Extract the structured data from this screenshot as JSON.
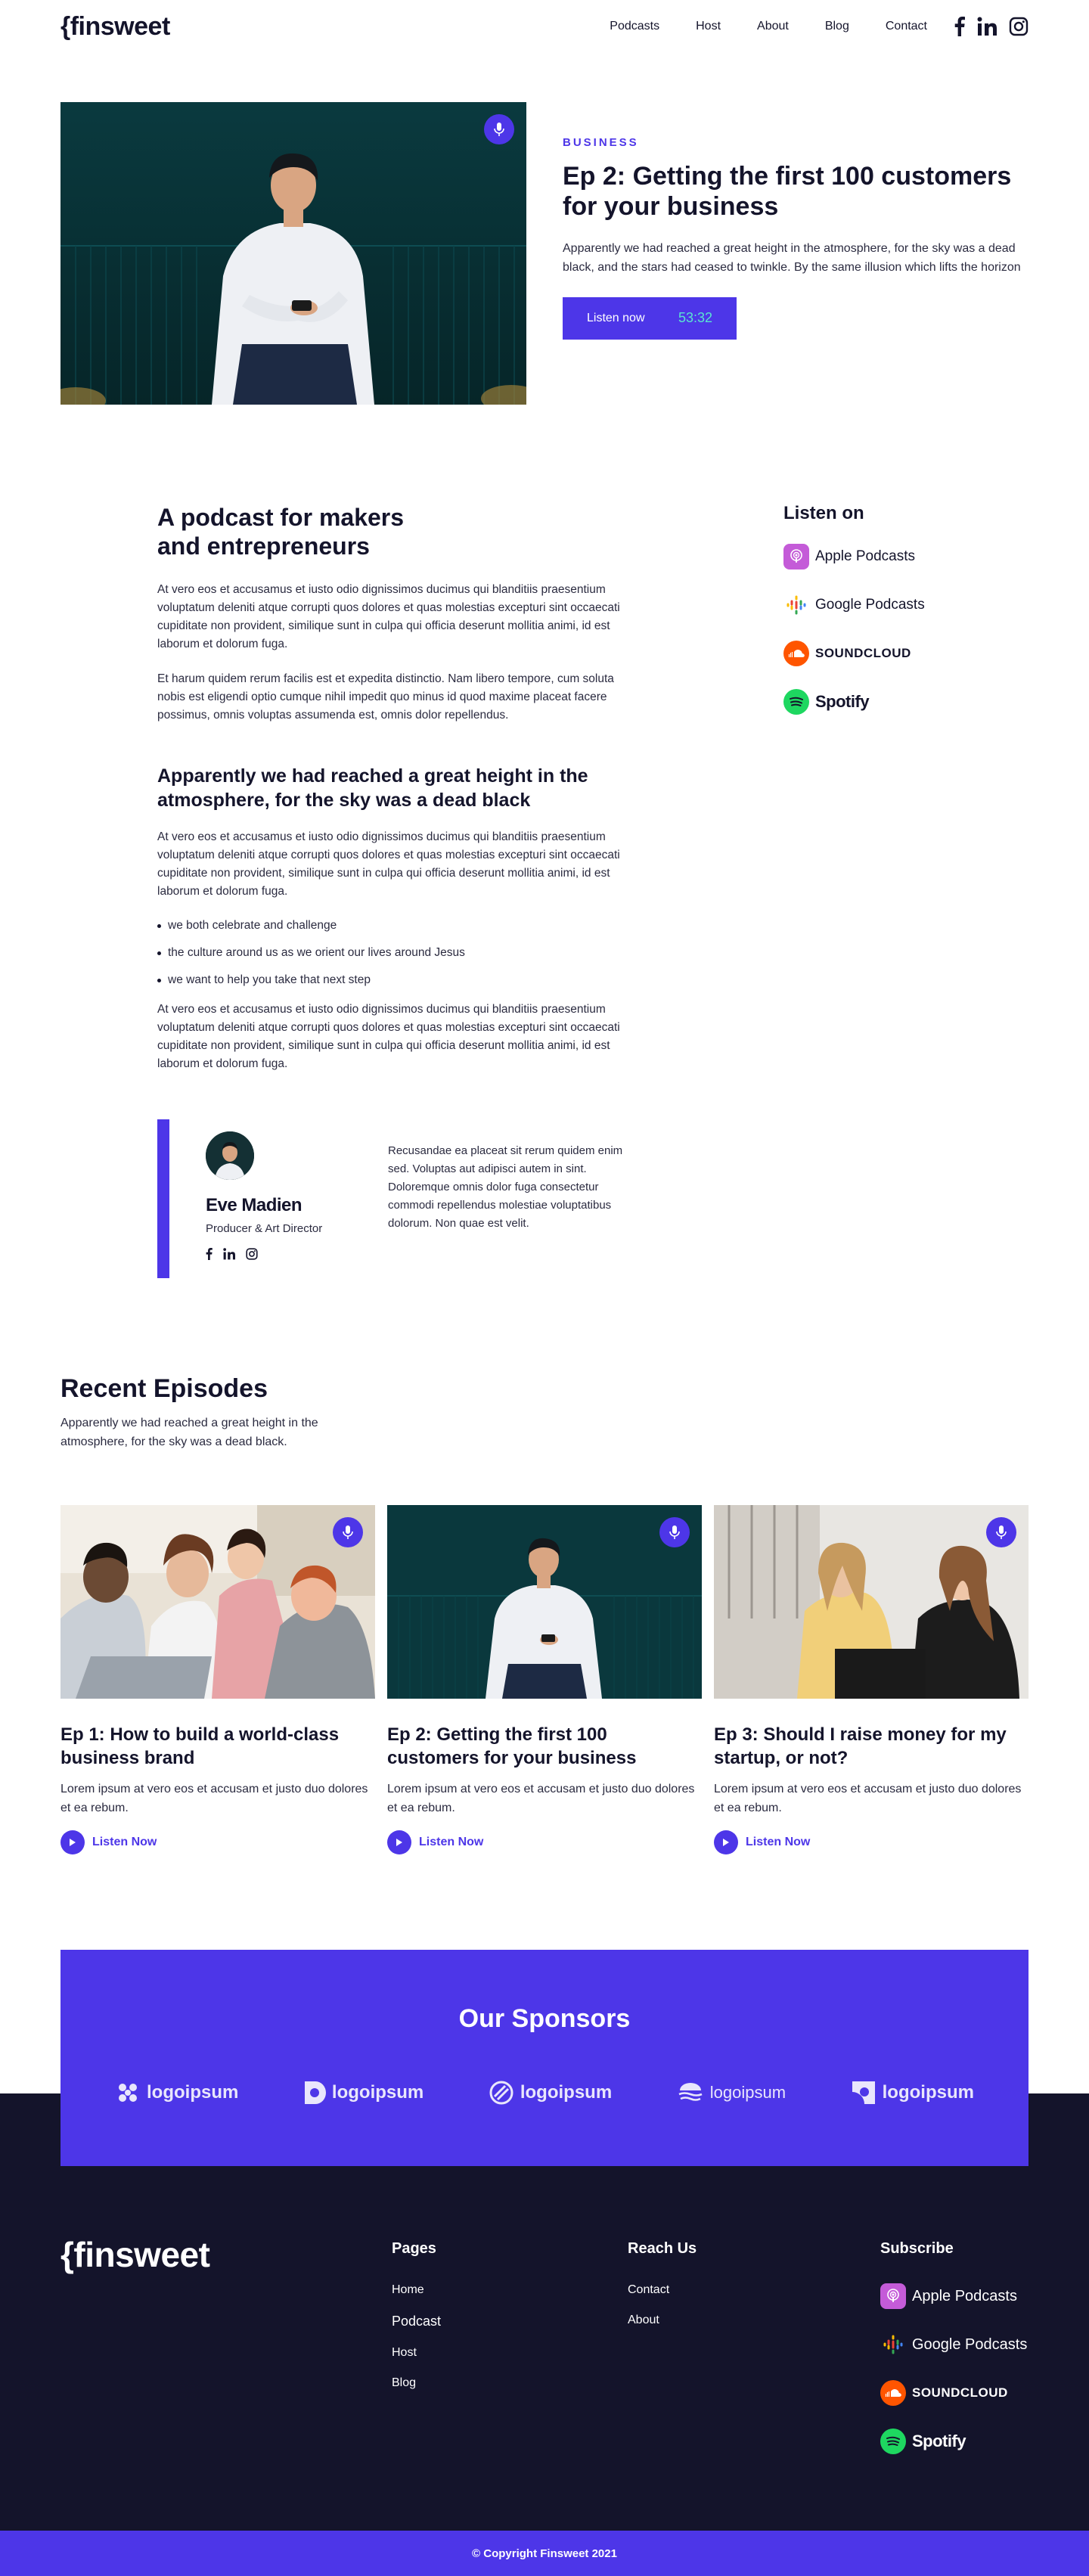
{
  "nav": {
    "logo": "{finsweet",
    "links": [
      "Podcasts",
      "Host",
      "About",
      "Blog",
      "Contact"
    ]
  },
  "hero": {
    "kicker": "BUSINESS",
    "title": "Ep 2: Getting the first 100 customers for your business",
    "description": "Apparently we had reached a great height in the atmosphere, for the sky was a dead black, and the stars had ceased to twinkle. By the same illusion which lifts the horizon",
    "button_label": "Listen now",
    "duration": "53:32"
  },
  "article": {
    "heading": "A podcast for makers and entrepreneurs",
    "para1": "At vero eos et accusamus et iusto odio dignissimos ducimus qui blanditiis praesentium voluptatum deleniti atque corrupti quos dolores et quas molestias excepturi sint occaecati cupiditate non provident, similique sunt in culpa qui officia deserunt mollitia animi, id est laborum et dolorum fuga.",
    "para2": "Et harum quidem rerum facilis est et expedita distinctio. Nam libero tempore, cum soluta nobis est eligendi optio cumque nihil impedit quo minus id quod maxime placeat facere possimus, omnis voluptas assumenda est, omnis dolor repellendus.",
    "subheading": "Apparently we had reached a great height in the atmosphere, for the sky was a dead black",
    "para3": "At vero eos et accusamus et iusto odio dignissimos ducimus qui blanditiis praesentium voluptatum deleniti atque corrupti quos dolores et quas molestias excepturi sint occaecati cupiditate non provident, similique sunt in culpa qui officia deserunt mollitia animi, id est laborum et dolorum fuga.",
    "bullets": [
      "we both celebrate and challenge",
      "the culture around us as we orient our lives around Jesus",
      "we want to help you take that next step"
    ],
    "para4": "At vero eos et accusamus et iusto odio dignissimos ducimus qui blanditiis praesentium voluptatum deleniti atque corrupti quos dolores et quas molestias excepturi sint occaecati cupiditate non provident, similique sunt in culpa qui officia deserunt mollitia animi, id est laborum et dolorum fuga."
  },
  "listen_on": {
    "title": "Listen on",
    "platforms": [
      "Apple Podcasts",
      "Google Podcasts",
      "SOUNDCLOUD",
      "Spotify"
    ]
  },
  "author": {
    "name": "Eve Madien",
    "role": "Producer & Art Director",
    "bio": "Recusandae ea placeat sit rerum quidem enim sed. Voluptas aut adipisci autem in sint. Doloremque omnis dolor fuga consectetur commodi repellendus molestiae voluptatibus dolorum. Non quae est velit."
  },
  "recent": {
    "title": "Recent Episodes",
    "subtitle": "Apparently we had reached a great height in the atmosphere, for the sky was a dead black.",
    "episodes": [
      {
        "title": "Ep 1: How to build a world-class business brand",
        "desc": "Lorem ipsum at vero eos et accusam et justo duo dolores et ea rebum.",
        "listen": "Listen Now"
      },
      {
        "title": "Ep 2: Getting the first 100 customers for your business",
        "desc": "Lorem ipsum at vero eos et accusam et justo duo dolores et ea rebum.",
        "listen": "Listen Now"
      },
      {
        "title": "Ep 3: Should I raise money for my startup, or not?",
        "desc": "Lorem ipsum at vero eos et accusam et justo duo dolores et ea rebum.",
        "listen": "Listen Now"
      }
    ]
  },
  "sponsors": {
    "title": "Our Sponsors",
    "logos": [
      "logoipsum",
      "logoipsum",
      "logoipsum",
      "logoipsum",
      "logoipsum"
    ]
  },
  "footer": {
    "logo": "{finsweet",
    "pages_title": "Pages",
    "pages": [
      "Home",
      "Podcast",
      "Host",
      "Blog"
    ],
    "reach_title": "Reach Us",
    "reach": [
      "Contact",
      "About"
    ],
    "subscribe_title": "Subscribe",
    "platforms": [
      "Apple Podcasts",
      "Google Podcasts",
      "SOUNDCLOUD",
      "Spotify"
    ],
    "copyright": "© Copyright Finsweet 2021"
  },
  "colors": {
    "accent": "#4d36e8",
    "dark": "#14142b",
    "duration": "#5ae4d1"
  }
}
